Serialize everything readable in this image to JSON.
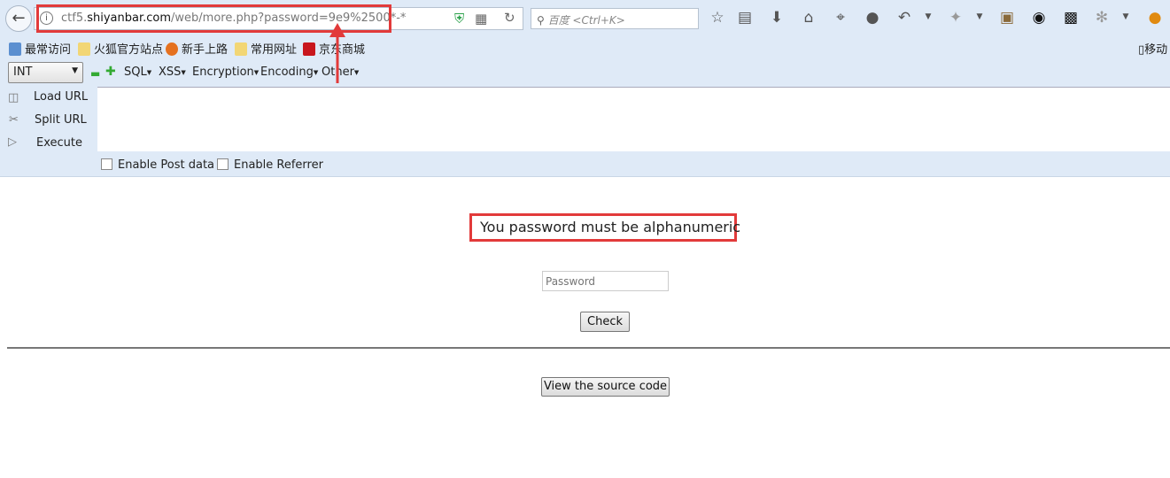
{
  "browser": {
    "url_host_prefix": "ctf5.",
    "url_host": "shiyanbar.com",
    "url_path": "/web/more.php?password=9e9%2500*-*",
    "search_placeholder": "百度 <Ctrl+K>",
    "toolbar_icons": [
      "star-icon",
      "reading-list-icon",
      "download-icon",
      "home-icon",
      "crop-icon",
      "chat-icon",
      "undo-icon",
      "extension-icon",
      "photo-icon",
      "location-icon",
      "owl-icon",
      "tool-icon",
      "avatar-icon"
    ],
    "bookmarks": [
      "最常访问",
      "火狐官方站点",
      "新手上路",
      "常用网址",
      "京东商城"
    ],
    "mobile_bookmarks": "移动"
  },
  "hackbar": {
    "select_value": "INT",
    "menus": [
      "SQL",
      "XSS",
      "Encryption",
      "Encoding",
      "Other"
    ],
    "actions": [
      "Load URL",
      "Split URL",
      "Execute"
    ],
    "textarea_value": "",
    "enable_post": "Enable Post data",
    "enable_referrer": "Enable Referrer"
  },
  "page": {
    "message": "You password must be alphanumeric",
    "password_placeholder": "Password",
    "check_label": "Check",
    "source_label": "View the source code"
  },
  "annotation_color": "#e23a3a"
}
